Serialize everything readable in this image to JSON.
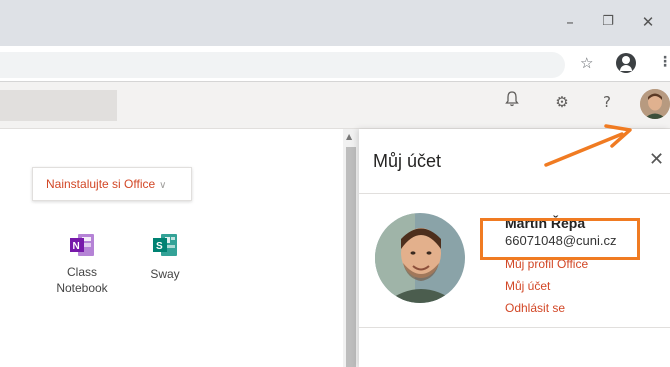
{
  "browser": {
    "window_controls": {
      "minimize": "–",
      "restore": "❐",
      "close": "✕"
    },
    "toolbar_icons": [
      "star-icon",
      "profile-icon",
      "menu-dots-icon"
    ]
  },
  "office": {
    "header_icons": [
      "bell-icon",
      "gear-icon",
      "help-icon",
      "avatar"
    ],
    "help_label": "?",
    "install_button": {
      "label": "Nainstalujte si Office",
      "chevron": "∨"
    },
    "apps": [
      {
        "name": "Class\nNotebook",
        "icon": "onenote-class-notebook-icon",
        "color": "#7719aa"
      },
      {
        "name": "Sway",
        "icon": "sway-icon",
        "color": "#008272"
      }
    ]
  },
  "account_panel": {
    "title": "Můj účet",
    "close_label": "✕",
    "user_name": "Martin Řepa",
    "user_email": "66071048@cuni.cz",
    "links": [
      "Můj profil Office",
      "Můj účet",
      "Odhlásit se"
    ]
  },
  "annotation": {
    "color": "#f07b22"
  }
}
